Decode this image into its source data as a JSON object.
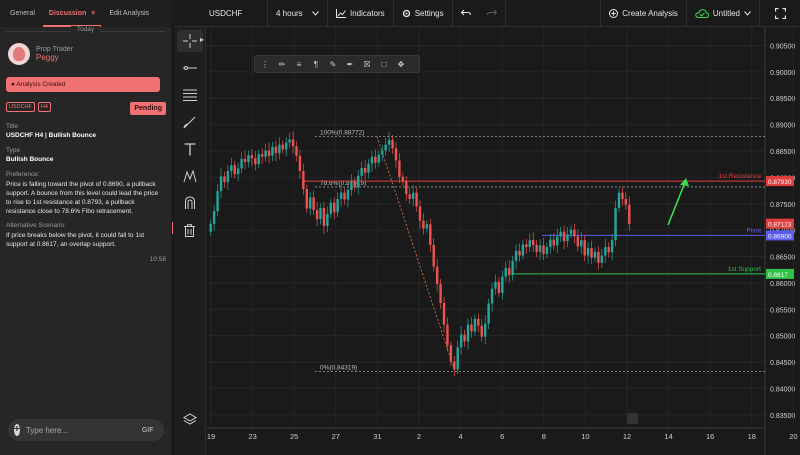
{
  "discussion": {
    "tabs": [
      {
        "label": "General"
      },
      {
        "label": "Discussion",
        "close": "×"
      },
      {
        "label": "Edit Analysis"
      }
    ],
    "day_separator": "Today",
    "author": {
      "role": "Prop Trader",
      "name": "Peggy"
    },
    "analysis_created": "Analysis Created",
    "badges": [
      "USDCHF",
      "H4"
    ],
    "status": "Pending",
    "title_label": "Title",
    "title_value": "USDCHF H4 | Bullish Bounce",
    "type_label": "Type",
    "type_value": "Bullish Bounce",
    "preference_label": "Preference:",
    "preference_text": "Price is falling toward the pivot of 0.8690, a pullback support. A bounce from this level could lead the price to rise to 1st resistance at 0.8793, a pullback resistance close to 78.6% Fibo retracement.",
    "alternative_label": "Alternative Scenario:",
    "alternative_text": "If price breaks below the pivot, it could fall to 1st support at 0.8617, an overlap support.",
    "time": "10:58",
    "compose_placeholder": "Type here...",
    "gif_label": "GIF"
  },
  "topbar": {
    "symbol": "USDCHF",
    "interval": "4 hours",
    "indicators": "Indicators",
    "settings": "Settings",
    "create_analysis": "Create Analysis",
    "saved_state": "Untitled"
  },
  "tools": [
    "crosshair-icon",
    "horizontal-line-icon",
    "fib-tool-icon",
    "brush-icon",
    "text-icon",
    "pattern-icon",
    "magnet-icon",
    "trash-icon"
  ],
  "colors": {
    "accent": "#f07171",
    "resistance": "#e03d3d",
    "pivot": "#5b5bf0",
    "support": "#2ec24a",
    "up_candle": "#26a69a",
    "down_candle": "#ef5350",
    "arrow": "#3ddc4a"
  },
  "chart_data": {
    "type": "candlestick",
    "symbol": "USDCHF",
    "interval": "4 hours",
    "x_ticks": [
      "19",
      "23",
      "25",
      "27",
      "31",
      "2",
      "4",
      "6",
      "8",
      "10",
      "12",
      "14",
      "16",
      "18",
      "20",
      "22"
    ],
    "y_ticks": [
      "0.90500",
      "0.90000",
      "0.89500",
      "0.89000",
      "0.88500",
      "0.88000",
      "0.87500",
      "0.87000",
      "0.86500",
      "0.86000",
      "0.85500",
      "0.85000",
      "0.84500",
      "0.84000",
      "0.83500"
    ],
    "ylim": [
      0.8325,
      0.9085
    ],
    "current_price_label": "0.87123",
    "fibonacci": [
      {
        "label": "100%(0.88772)",
        "price": 0.88772
      },
      {
        "label": "78.6%(0.87819)",
        "price": 0.87819
      },
      {
        "label": "0%(0.84319)",
        "price": 0.84319
      }
    ],
    "levels": [
      {
        "name": "1st Resistance",
        "price": 0.8793,
        "label": "0.87930",
        "color": "#e03d3d"
      },
      {
        "name": "Pivot",
        "price": 0.869,
        "label": "0.86900",
        "color": "#5b5bf0"
      },
      {
        "name": "1st Support",
        "price": 0.8617,
        "label": "0.8617",
        "color": "#2ec24a"
      }
    ],
    "ohlc_close": [
      0.8712,
      0.8736,
      0.8774,
      0.8802,
      0.8791,
      0.8812,
      0.8823,
      0.8806,
      0.8817,
      0.8835,
      0.8829,
      0.8842,
      0.8836,
      0.8825,
      0.8844,
      0.8839,
      0.8851,
      0.8841,
      0.8858,
      0.8846,
      0.8862,
      0.8853,
      0.8866,
      0.8872,
      0.8859,
      0.8841,
      0.8812,
      0.8778,
      0.8741,
      0.8762,
      0.8738,
      0.8721,
      0.8742,
      0.8708,
      0.8731,
      0.8752,
      0.8734,
      0.8759,
      0.8771,
      0.8758,
      0.8776,
      0.8792,
      0.8781,
      0.8803,
      0.8818,
      0.8809,
      0.8826,
      0.8839,
      0.8828,
      0.8843,
      0.8851,
      0.8862,
      0.8871,
      0.8855,
      0.8832,
      0.8801,
      0.8792,
      0.8768,
      0.8759,
      0.8771,
      0.8745,
      0.8718,
      0.8703,
      0.8711,
      0.8672,
      0.8631,
      0.8598,
      0.8562,
      0.8521,
      0.8482,
      0.8451,
      0.8436,
      0.8478,
      0.8502,
      0.8489,
      0.8521,
      0.8508,
      0.8532,
      0.8519,
      0.8498,
      0.8523,
      0.8561,
      0.8589,
      0.8602,
      0.8581,
      0.8612,
      0.8628,
      0.8615,
      0.8642,
      0.8661,
      0.8652,
      0.8673,
      0.8668,
      0.8681,
      0.8672,
      0.8659,
      0.8671,
      0.8655,
      0.8668,
      0.8682,
      0.8671,
      0.8688,
      0.8697,
      0.8679,
      0.8692,
      0.8701,
      0.8688,
      0.8669,
      0.8681,
      0.8652,
      0.8666,
      0.8648,
      0.8659,
      0.8638,
      0.8652,
      0.8668,
      0.8658,
      0.8681,
      0.8742,
      0.8771,
      0.8759,
      0.8748,
      0.8712
    ]
  }
}
